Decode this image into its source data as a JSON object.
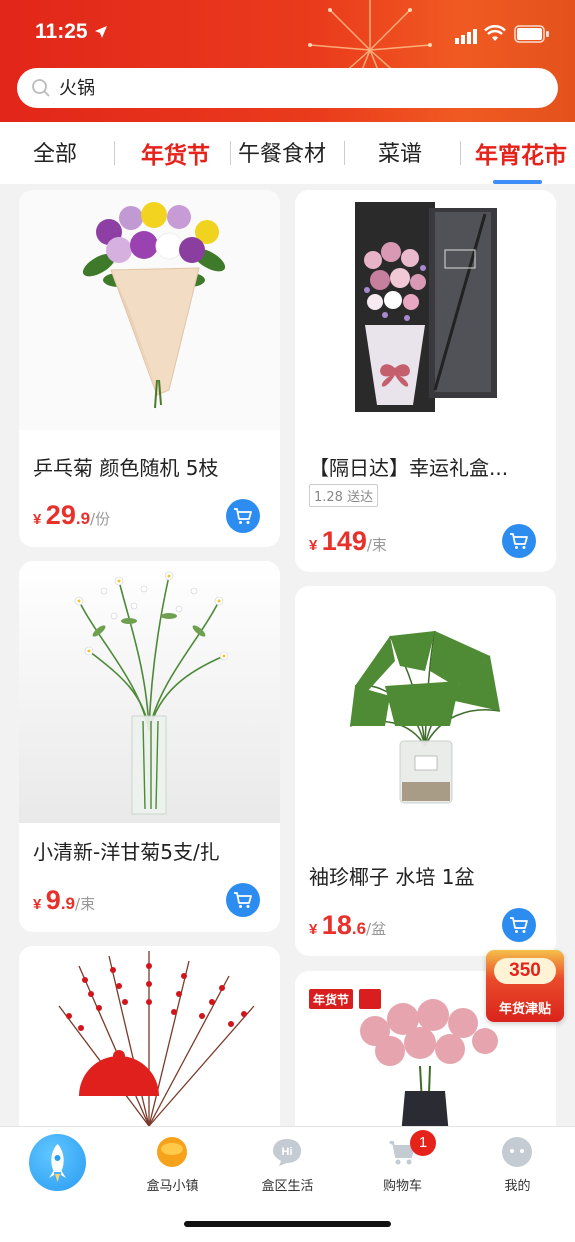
{
  "status_bar": {
    "time": "11:25"
  },
  "search": {
    "value": "火锅"
  },
  "tabs": [
    {
      "label": "全部"
    },
    {
      "label": "年货节"
    },
    {
      "label": "午餐食材"
    },
    {
      "label": "菜谱"
    },
    {
      "label": "年宵花市",
      "active": true
    }
  ],
  "products": [
    {
      "title": "乒乓菊 颜色随机 5枝",
      "price_symbol": "¥",
      "price_int": "29",
      "price_dec": ".9",
      "unit": "/份"
    },
    {
      "title": "【隔日达】幸运礼盒...",
      "tag": "1.28 送达",
      "price_symbol": "¥",
      "price_int": "149",
      "price_dec": "",
      "unit": "/束"
    },
    {
      "title": "小清新-洋甘菊5支/扎",
      "price_symbol": "¥",
      "price_int": "9",
      "price_dec": ".9",
      "unit": "/束"
    },
    {
      "title": "袖珍椰子 水培 1盆",
      "price_symbol": "¥",
      "price_int": "18",
      "price_dec": ".6",
      "unit": "/盆"
    },
    {
      "badge": "年货节"
    }
  ],
  "floater": {
    "amount": "350",
    "label": "年货津贴"
  },
  "bottom_nav": [
    {
      "label": ""
    },
    {
      "label": "盒马小镇"
    },
    {
      "label": "盒区生活"
    },
    {
      "label": "购物车",
      "badge": "1"
    },
    {
      "label": "我的"
    }
  ],
  "colors": {
    "brand_red": "#e5231b",
    "accent_blue": "#2d8cf0",
    "tab_underline": "#3e8ef7"
  }
}
